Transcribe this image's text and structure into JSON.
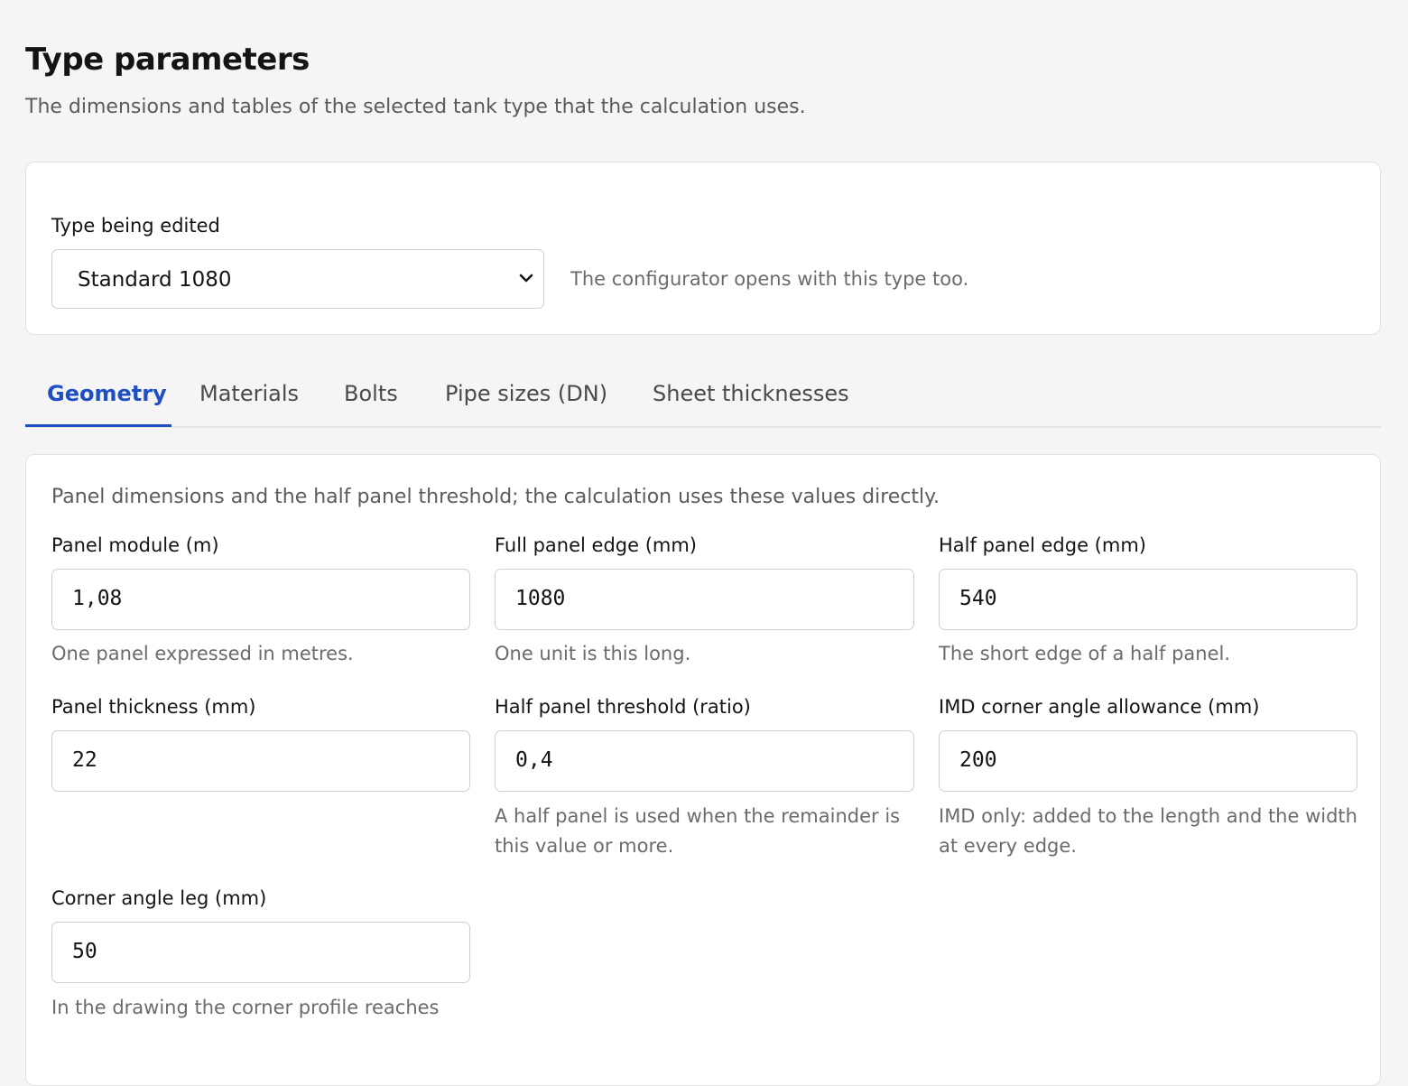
{
  "header": {
    "title": "Type parameters",
    "subtitle": "The dimensions and tables of the selected tank type that the calculation uses."
  },
  "type_select": {
    "label": "Type being edited",
    "value": "Standard 1080",
    "help": "The configurator opens with this type too."
  },
  "tabs": [
    {
      "label": "Geometry",
      "active": true
    },
    {
      "label": "Materials",
      "active": false
    },
    {
      "label": "Bolts",
      "active": false
    },
    {
      "label": "Pipe sizes (DN)",
      "active": false
    },
    {
      "label": "Sheet thicknesses",
      "active": false
    }
  ],
  "geometry": {
    "intro": "Panel dimensions and the half panel threshold; the calculation uses these values directly.",
    "fields": [
      {
        "label": "Panel module (m)",
        "value": "1,08",
        "help": "One panel expressed in metres."
      },
      {
        "label": "Full panel edge (mm)",
        "value": "1080",
        "help": "One unit is this long."
      },
      {
        "label": "Half panel edge (mm)",
        "value": "540",
        "help": "The short edge of a half panel."
      },
      {
        "label": "Panel thickness (mm)",
        "value": "22",
        "help": ""
      },
      {
        "label": "Half panel threshold (ratio)",
        "value": "0,4",
        "help": "A half panel is used when the remainder is this value or more."
      },
      {
        "label": "IMD corner angle allowance (mm)",
        "value": "200",
        "help": "IMD only: added to the length and the width at every edge."
      },
      {
        "label": "Corner angle leg (mm)",
        "value": "50",
        "help": "In the drawing the corner profile reaches"
      }
    ]
  },
  "colors": {
    "accent": "#1f4fc4",
    "background": "#f5f5f5",
    "card": "#ffffff",
    "muted_text": "#6b6b6b"
  }
}
